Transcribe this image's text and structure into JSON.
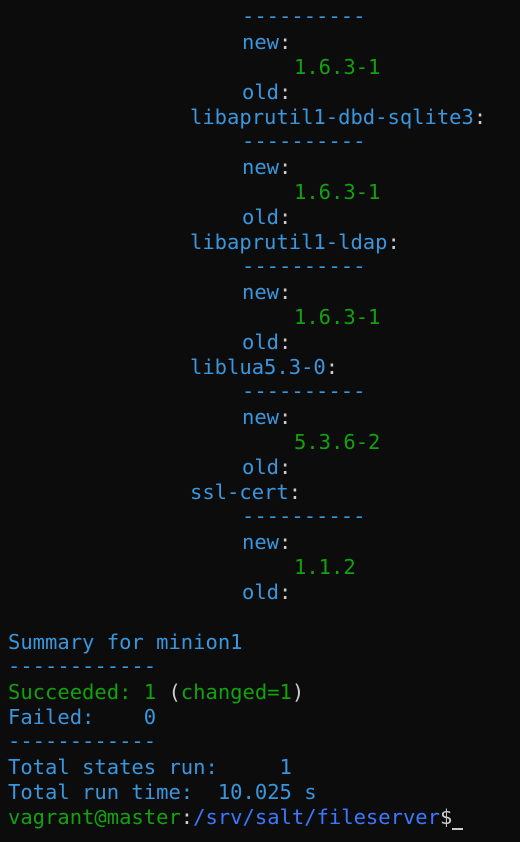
{
  "packages": [
    {
      "name": "",
      "new": "1.6.3-1"
    },
    {
      "name": "libaprutil1-dbd-sqlite3",
      "new": "1.6.3-1"
    },
    {
      "name": "libaprutil1-ldap",
      "new": "1.6.3-1"
    },
    {
      "name": "liblua5.3-0",
      "new": "5.3.6-2"
    },
    {
      "name": "ssl-cert",
      "new": "1.1.2"
    }
  ],
  "labels": {
    "separator": "----------",
    "new": "new",
    "old": "old",
    "colon": ":"
  },
  "summary": {
    "title": "Summary for minion1",
    "separator": "------------",
    "succeeded_label": "Succeeded:",
    "succeeded_value": "1",
    "changed_open": "(",
    "changed_label": "changed=1",
    "changed_close": ")",
    "failed_label": "Failed:",
    "failed_value": "0",
    "total_states_label": "Total states run:",
    "total_states_value": "1",
    "total_time_label": "Total run time:",
    "total_time_value": "10.025 s"
  },
  "prompt": {
    "user_host": "vagrant@master",
    "colon": ":",
    "path": "/srv/salt/fileserver",
    "symbol": "$"
  },
  "colors": {
    "background": "#0c0c0c",
    "key_blue": "#3a96dd",
    "value_green": "#13a10e",
    "text": "#cccccc",
    "path_blue": "#3b78ff"
  }
}
